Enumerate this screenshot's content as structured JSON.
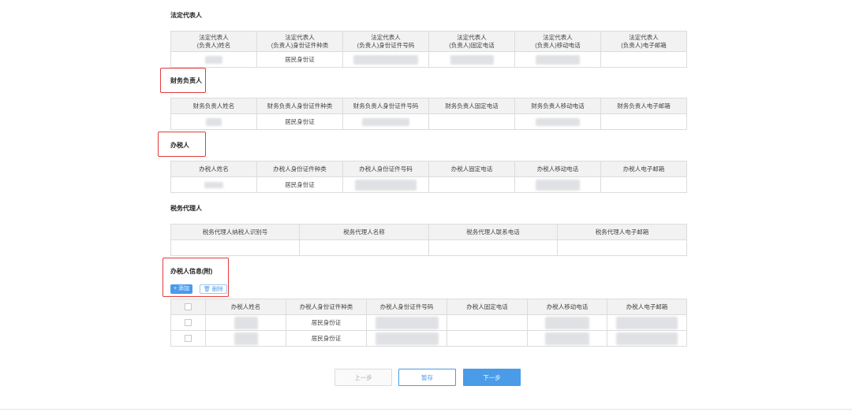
{
  "legal_rep": {
    "title": "法定代表人",
    "headers": [
      [
        "法定代表人",
        "(负责人)姓名"
      ],
      [
        "法定代表人",
        "(负责人)身份证件种类"
      ],
      [
        "法定代表人",
        "(负责人)身份证件号码"
      ],
      [
        "法定代表人",
        "(负责人)固定电话"
      ],
      [
        "法定代表人",
        "(负责人)移动电话"
      ],
      [
        "法定代表人",
        "(负责人)电子邮箱"
      ]
    ],
    "row": {
      "id_type": "居民身份证"
    }
  },
  "finance": {
    "title": "财务负责人",
    "headers": [
      "财务负责人姓名",
      "财务负责人身份证件种类",
      "财务负责人身份证件号码",
      "财务负责人固定电话",
      "财务负责人移动电话",
      "财务负责人电子邮箱"
    ],
    "row": {
      "id_type": "居民身份证"
    }
  },
  "tax_handler": {
    "title": "办税人",
    "headers": [
      "办税人姓名",
      "办税人身份证件种类",
      "办税人身份证件号码",
      "办税人固定电话",
      "办税人移动电话",
      "办税人电子邮箱"
    ],
    "row": {
      "id_type": "居民身份证"
    }
  },
  "tax_agent": {
    "title": "税务代理人",
    "headers": [
      "税务代理人纳税人识别号",
      "税务代理人名称",
      "税务代理人联系电话",
      "税务代理人电子邮箱"
    ]
  },
  "handler_info": {
    "title": "办税人信息(附)",
    "add_label": "+ 添加",
    "delete_label": "🗑 删除",
    "headers": [
      "办税人姓名",
      "办税人身份证件种类",
      "办税人身份证件号码",
      "办税人固定电话",
      "办税人移动电话",
      "办税人电子邮箱"
    ],
    "rows": [
      {
        "id_type": "居民身份证"
      },
      {
        "id_type": "居民身份证"
      }
    ]
  },
  "nav": {
    "prev_label": "上一步",
    "save_label": "暂存",
    "next_label": "下一步"
  }
}
